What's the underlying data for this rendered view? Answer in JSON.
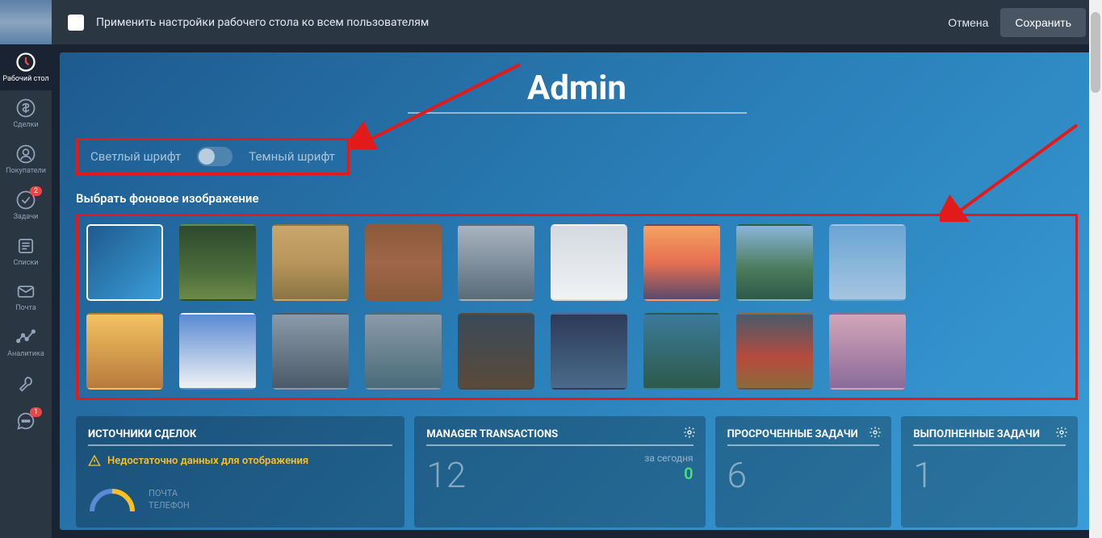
{
  "sidebar": {
    "items": [
      {
        "label": "Рабочий стол",
        "icon": "dashboard",
        "active": true
      },
      {
        "label": "Сделки",
        "icon": "dollar"
      },
      {
        "label": "Покупатели",
        "icon": "users"
      },
      {
        "label": "Задачи",
        "icon": "checkmark",
        "badge": "2"
      },
      {
        "label": "Списки",
        "icon": "list"
      },
      {
        "label": "Почта",
        "icon": "mail"
      },
      {
        "label": "Аналитика",
        "icon": "analytics"
      },
      {
        "label": "",
        "icon": "wrench"
      },
      {
        "label": "",
        "icon": "chat",
        "badge": "1"
      }
    ]
  },
  "topbar": {
    "checkbox_label": "Применить настройки рабочего стола ко всем пользователям",
    "cancel": "Отмена",
    "save": "Сохранить"
  },
  "page_title": "Admin",
  "font_toggle": {
    "light": "Светлый шрифт",
    "dark": "Темный шрифт"
  },
  "bg_section_label": "Выбрать фоновое изображение",
  "bg_thumbs": {
    "row1": [
      {
        "id": "blue-gradient",
        "bg": "linear-gradient(135deg,#1e5a8e,#3a9dd8)",
        "selected": true
      },
      {
        "id": "forest",
        "bg": "linear-gradient(180deg,#2d4a2d 0%,#4a6b3a 60%,#6b8a4a 100%)"
      },
      {
        "id": "wheat",
        "bg": "linear-gradient(180deg,#c9a66b 0%,#b8955a 50%,#8a7545 100%)"
      },
      {
        "id": "wood",
        "bg": "linear-gradient(180deg,#8b5a3c 0%,#a0674a 50%,#8b5a3c 100%)"
      },
      {
        "id": "city",
        "bg": "linear-gradient(180deg,#a8b4bf 0%,#5a6b7a 100%)"
      },
      {
        "id": "winter-tree",
        "bg": "linear-gradient(180deg,#d4dae0 0%,#f0f2f4 100%)"
      },
      {
        "id": "sunset-sea",
        "bg": "linear-gradient(180deg,#f4a261 0%,#e76f51 50%,#5a4a6b 100%)"
      },
      {
        "id": "islands",
        "bg": "linear-gradient(180deg,#8ab4d8 0%,#4a7a5a 60%,#2d5a4a 100%)"
      },
      {
        "id": "balloons",
        "bg": "linear-gradient(180deg,#6ba5d4 0%,#a5c5e0 100%)"
      }
    ],
    "row2": [
      {
        "id": "golden-gate",
        "bg": "linear-gradient(180deg,#f4c261 0%,#b87a3c 100%)"
      },
      {
        "id": "clouds",
        "bg": "linear-gradient(180deg,#5a8ad4 0%,#f0f2f4 100%)"
      },
      {
        "id": "ocean",
        "bg": "linear-gradient(180deg,#8a9aa8 0%,#4a5a68 100%)"
      },
      {
        "id": "mountain-fog",
        "bg": "linear-gradient(180deg,#8a9aa8 0%,#4a6b7a 100%)"
      },
      {
        "id": "rain",
        "bg": "linear-gradient(180deg,#3a4a5a 0%,#5a4a3a 100%)"
      },
      {
        "id": "night-city",
        "bg": "linear-gradient(180deg,#2d3a5a 0%,#4a6b8a 100%)"
      },
      {
        "id": "river",
        "bg": "linear-gradient(180deg,#3a7a9a 0%,#2d5a4a 100%)"
      },
      {
        "id": "autumn",
        "bg": "linear-gradient(180deg,#4a5a6b 0%,#b84a3c 60%,#8a6b3a 100%)"
      },
      {
        "id": "pink-mist",
        "bg": "linear-gradient(180deg,#d4a5b8 0%,#8a6b9a 100%)"
      }
    ]
  },
  "widgets": [
    {
      "title": "ИСТОЧНИКИ СДЕЛОК",
      "warning": "Недостаточно данных для отображения",
      "legend": [
        "ПОЧТА",
        "ТЕЛЕФОН"
      ]
    },
    {
      "title": "MANAGER TRANSACTIONS",
      "value": "12",
      "sub_label": "за сегодня",
      "sub_value": "0"
    },
    {
      "title": "ПРОСРОЧЕННЫЕ ЗАДАЧИ",
      "value": "6"
    },
    {
      "title": "ВЫПОЛНЕННЫЕ ЗАДАЧИ",
      "value": "1"
    }
  ]
}
